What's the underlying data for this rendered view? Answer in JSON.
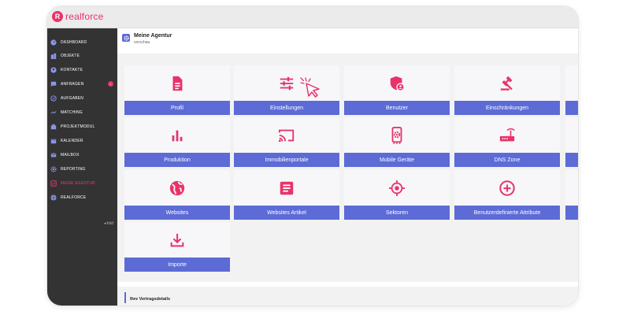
{
  "app": {
    "logo_letter": "R",
    "logo_text": "realforce"
  },
  "sidebar": {
    "items": [
      {
        "label": "DASHBOARD",
        "icon": "gauge-icon"
      },
      {
        "label": "OBJEKTE",
        "icon": "buildings-icon"
      },
      {
        "label": "KONTAKTE",
        "icon": "person-icon"
      },
      {
        "label": "ANFRAGEN",
        "icon": "chat-icon",
        "badge": "•"
      },
      {
        "label": "AUFGABEN",
        "icon": "check-circle-icon"
      },
      {
        "label": "MATCHING",
        "icon": "matching-icon"
      },
      {
        "label": "PROJEKTMODUL",
        "icon": "project-icon"
      },
      {
        "label": "KALENDER",
        "icon": "calendar-icon"
      },
      {
        "label": "MAILBOX",
        "icon": "mail-icon"
      },
      {
        "label": "REPORTING",
        "icon": "gear-icon"
      },
      {
        "label": "MEINE AGENTUR",
        "icon": "agency-icon",
        "active": true
      },
      {
        "label": "REALFORCE",
        "icon": "globe-icon"
      }
    ],
    "collapse_label": "◂ fold"
  },
  "page": {
    "title": "Meine Agentur",
    "subtitle": "vorschau"
  },
  "tiles": [
    {
      "label": "Profil",
      "icon": "document-icon"
    },
    {
      "label": "Einstellungen",
      "icon": "sliders-icon"
    },
    {
      "label": "Benutzer",
      "icon": "user-shield-icon"
    },
    {
      "label": "Einschränkungen",
      "icon": "gavel-icon"
    },
    {
      "label": "Produktion",
      "icon": "bar-chart-icon"
    },
    {
      "label": "Immobilienportale",
      "icon": "cast-icon"
    },
    {
      "label": "Mobile Geräte",
      "icon": "mobile-settings-icon"
    },
    {
      "label": "DNS Zone",
      "icon": "router-icon"
    },
    {
      "label": "Websites",
      "icon": "globe-icon"
    },
    {
      "label": "Websites Artikel",
      "icon": "article-icon"
    },
    {
      "label": "Sektoren",
      "icon": "target-icon"
    },
    {
      "label": "Benutzerdefinierte Attribute",
      "icon": "plus-circle-icon"
    },
    {
      "label": "Importe",
      "icon": "download-icon"
    }
  ],
  "contract": {
    "title": "Ihre Vertragsdetails"
  },
  "colors": {
    "accent": "#e8336a",
    "tile_bar": "#5c6bd6",
    "sidebar": "#333333"
  }
}
